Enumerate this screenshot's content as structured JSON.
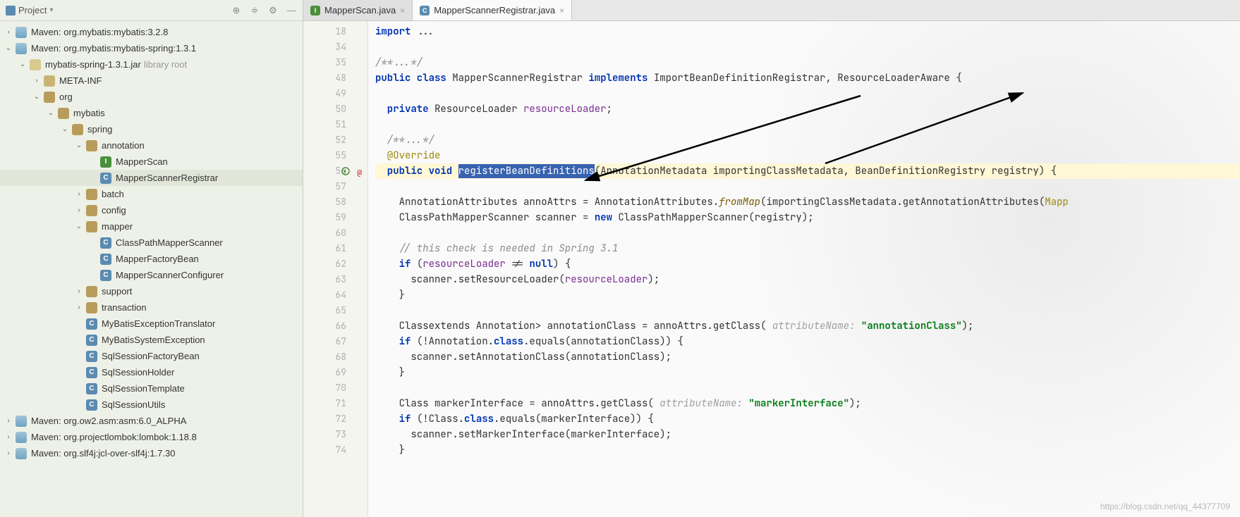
{
  "sidebar": {
    "title": "Project",
    "tools": [
      "target",
      "sort",
      "gear",
      "minimize"
    ],
    "tree": [
      {
        "d": 0,
        "exp": ">",
        "icon": "maven",
        "label": "Maven: org.mybatis:mybatis:3.2.8"
      },
      {
        "d": 0,
        "exp": "v",
        "icon": "maven",
        "label": "Maven: org.mybatis:mybatis-spring:1.3.1"
      },
      {
        "d": 1,
        "exp": "v",
        "icon": "jar",
        "label": "mybatis-spring-1.3.1.jar",
        "hint": "library root"
      },
      {
        "d": 2,
        "exp": ">",
        "icon": "folder",
        "label": "META-INF"
      },
      {
        "d": 2,
        "exp": "v",
        "icon": "pkg",
        "label": "org"
      },
      {
        "d": 3,
        "exp": "v",
        "icon": "pkg",
        "label": "mybatis"
      },
      {
        "d": 4,
        "exp": "v",
        "icon": "pkg",
        "label": "spring"
      },
      {
        "d": 5,
        "exp": "v",
        "icon": "pkg",
        "label": "annotation"
      },
      {
        "d": 6,
        "exp": "",
        "icon": "class-i",
        "label": "MapperScan"
      },
      {
        "d": 6,
        "exp": "",
        "icon": "class-c",
        "label": "MapperScannerRegistrar",
        "sel": true
      },
      {
        "d": 5,
        "exp": ">",
        "icon": "pkg",
        "label": "batch"
      },
      {
        "d": 5,
        "exp": ">",
        "icon": "pkg",
        "label": "config"
      },
      {
        "d": 5,
        "exp": "v",
        "icon": "pkg",
        "label": "mapper"
      },
      {
        "d": 6,
        "exp": "",
        "icon": "class-c",
        "label": "ClassPathMapperScanner"
      },
      {
        "d": 6,
        "exp": "",
        "icon": "class-c",
        "label": "MapperFactoryBean"
      },
      {
        "d": 6,
        "exp": "",
        "icon": "class-c",
        "label": "MapperScannerConfigurer"
      },
      {
        "d": 5,
        "exp": ">",
        "icon": "pkg",
        "label": "support"
      },
      {
        "d": 5,
        "exp": ">",
        "icon": "pkg",
        "label": "transaction"
      },
      {
        "d": 5,
        "exp": "",
        "icon": "class-c",
        "label": "MyBatisExceptionTranslator"
      },
      {
        "d": 5,
        "exp": "",
        "icon": "class-c",
        "label": "MyBatisSystemException"
      },
      {
        "d": 5,
        "exp": "",
        "icon": "class-c",
        "label": "SqlSessionFactoryBean"
      },
      {
        "d": 5,
        "exp": "",
        "icon": "class-c",
        "label": "SqlSessionHolder"
      },
      {
        "d": 5,
        "exp": "",
        "icon": "class-c",
        "label": "SqlSessionTemplate"
      },
      {
        "d": 5,
        "exp": "",
        "icon": "class-c",
        "label": "SqlSessionUtils"
      },
      {
        "d": 0,
        "exp": ">",
        "icon": "maven",
        "label": "Maven: org.ow2.asm:asm:6.0_ALPHA"
      },
      {
        "d": 0,
        "exp": ">",
        "icon": "maven",
        "label": "Maven: org.projectlombok:lombok:1.18.8"
      },
      {
        "d": 0,
        "exp": ">",
        "icon": "maven",
        "label": "Maven: org.slf4j:jcl-over-slf4j:1.7.30"
      }
    ]
  },
  "tabs": [
    {
      "icon": "class-i",
      "label": "MapperScan.java",
      "active": false
    },
    {
      "icon": "class-c",
      "label": "MapperScannerRegistrar.java",
      "active": true
    }
  ],
  "lineNumbers": [
    "18",
    "34",
    "35",
    "48",
    "49",
    "50",
    "51",
    "52",
    "55",
    "56",
    "57",
    "58",
    "59",
    "60",
    "61",
    "62",
    "63",
    "64",
    "65",
    "66",
    "67",
    "68",
    "69",
    "70",
    "71",
    "72",
    "73",
    "74"
  ],
  "code": {
    "l18": {
      "pre": "import ",
      "post": "..."
    },
    "l35": "/**...*/",
    "l48": {
      "a": "public class ",
      "b": "MapperScannerRegistrar ",
      "c": "implements ",
      "d": "ImportBeanDefinitionRegistrar, ResourceLoaderAware {"
    },
    "l50": {
      "a": "  private ",
      "b": "ResourceLoader ",
      "c": "resourceLoader",
      "d": ";"
    },
    "l52": "  /**...*/",
    "l55": "  @Override",
    "l56": {
      "a": "  public void ",
      "sel": "registerBeanDefinitions",
      "b": "(AnnotationMetadata importingClassMetadata, BeanDefinitionRegistry registry) {"
    },
    "l58": {
      "a": "    AnnotationAttributes annoAttrs = AnnotationAttributes.",
      "b": "fromMap",
      "c": "(importingClassMetadata.getAnnotationAttributes(",
      "d": "Mapp"
    },
    "l59": {
      "a": "    ClassPathMapperScanner scanner = ",
      "b": "new ",
      "c": "ClassPathMapperScanner(registry);"
    },
    "l61": "    // this check is needed in Spring 3.1",
    "l62": {
      "a": "    if ",
      "b": "(",
      "c": "resourceLoader",
      "d": " != ",
      "e": "null",
      "f": ") {"
    },
    "l63": {
      "a": "      scanner.setResourceLoader(",
      "b": "resourceLoader",
      "c": ");"
    },
    "l64": "    }",
    "l66": {
      "a": "    Class<? ",
      "b": "extends ",
      "c": "Annotation> annotationClass = annoAttrs.getClass( ",
      "h": "attributeName:",
      "d": " \"annotationClass\"",
      "e": ");"
    },
    "l67": {
      "a": "    if ",
      "b": "(!Annotation.",
      "c": "class",
      "d": ".equals(annotationClass)) {"
    },
    "l68": "      scanner.setAnnotationClass(annotationClass);",
    "l69": "    }",
    "l71": {
      "a": "    Class<?> markerInterface = annoAttrs.getClass( ",
      "h": "attributeName:",
      "b": " \"markerInterface\"",
      "c": ");"
    },
    "l72": {
      "a": "    if ",
      "b": "(!Class.",
      "c": "class",
      "d": ".equals(markerInterface)) {"
    },
    "l73": "      scanner.setMarkerInterface(markerInterface);",
    "l74": "    }"
  },
  "watermark": "https://blog.csdn.net/qq_44377709"
}
